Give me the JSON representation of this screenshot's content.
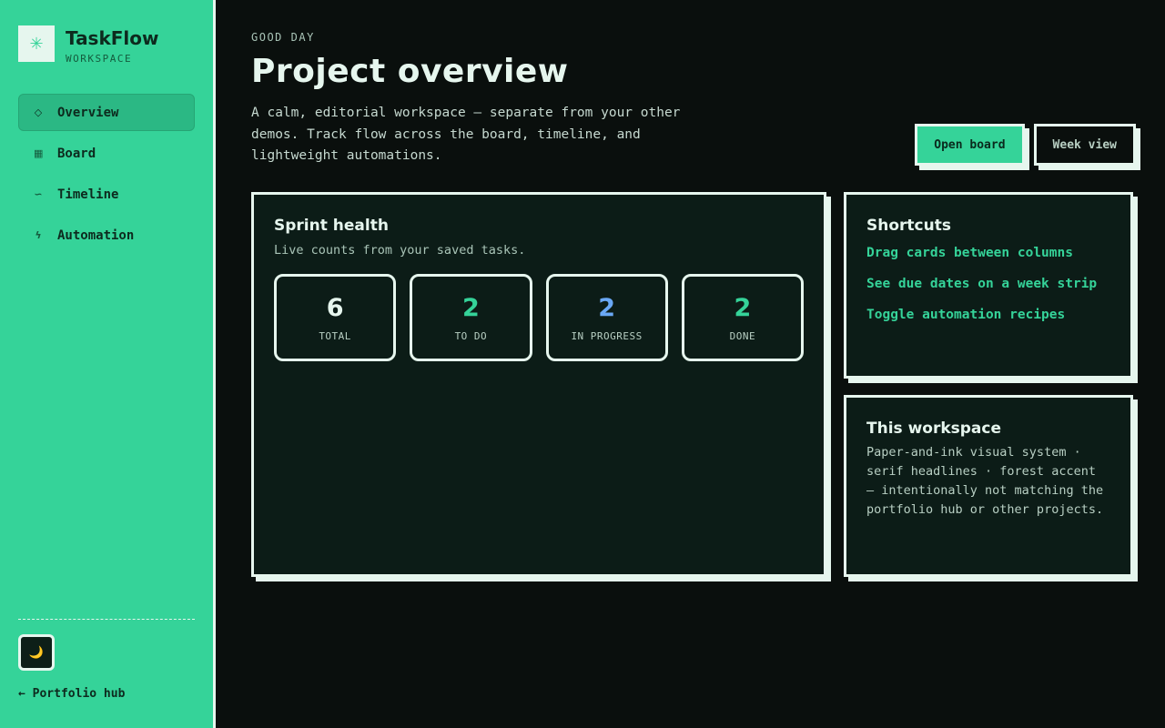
{
  "brand": {
    "logo_glyph": "✳",
    "name": "TaskFlow",
    "subtitle": "WORKSPACE"
  },
  "sidebar": {
    "items": [
      {
        "label": "Overview",
        "icon": "diamond-icon",
        "glyph": "◇",
        "active": true
      },
      {
        "label": "Board",
        "icon": "grid-icon",
        "glyph": "▦",
        "active": false
      },
      {
        "label": "Timeline",
        "icon": "wave-icon",
        "glyph": "∽",
        "active": false
      },
      {
        "label": "Automation",
        "icon": "bolt-icon",
        "glyph": "ϟ",
        "active": false
      }
    ],
    "theme_toggle_glyph": "🌙",
    "back_link": "← Portfolio hub"
  },
  "header": {
    "greeting": "GOOD DAY",
    "title": "Project overview",
    "intro": "A calm, editorial workspace — separate from your other demos. Track flow across the board, timeline, and lightweight automations.",
    "primary_action": "Open board",
    "secondary_action": "Week view"
  },
  "sprint": {
    "title": "Sprint health",
    "subtitle": "Live counts from your saved tasks.",
    "stats": [
      {
        "value": "6",
        "label": "TOTAL",
        "color": "#e6f6ee"
      },
      {
        "value": "2",
        "label": "TO DO",
        "color": "#35d399"
      },
      {
        "value": "2",
        "label": "IN PROGRESS",
        "color": "#6aa8f5"
      },
      {
        "value": "2",
        "label": "DONE",
        "color": "#35d399"
      }
    ]
  },
  "shortcuts": {
    "title": "Shortcuts",
    "items": [
      "Drag cards between columns",
      "See due dates on a week strip",
      "Toggle automation recipes"
    ]
  },
  "workspace": {
    "title": "This workspace",
    "body": "Paper-and-ink visual system · serif headlines · forest accent — intentionally not matching the portfolio hub or other projects."
  },
  "colors": {
    "accent": "#35d399",
    "background": "#0a0f0d",
    "card": "#0c1c17",
    "ink": "#e6f6ee",
    "in_progress": "#6aa8f5"
  }
}
